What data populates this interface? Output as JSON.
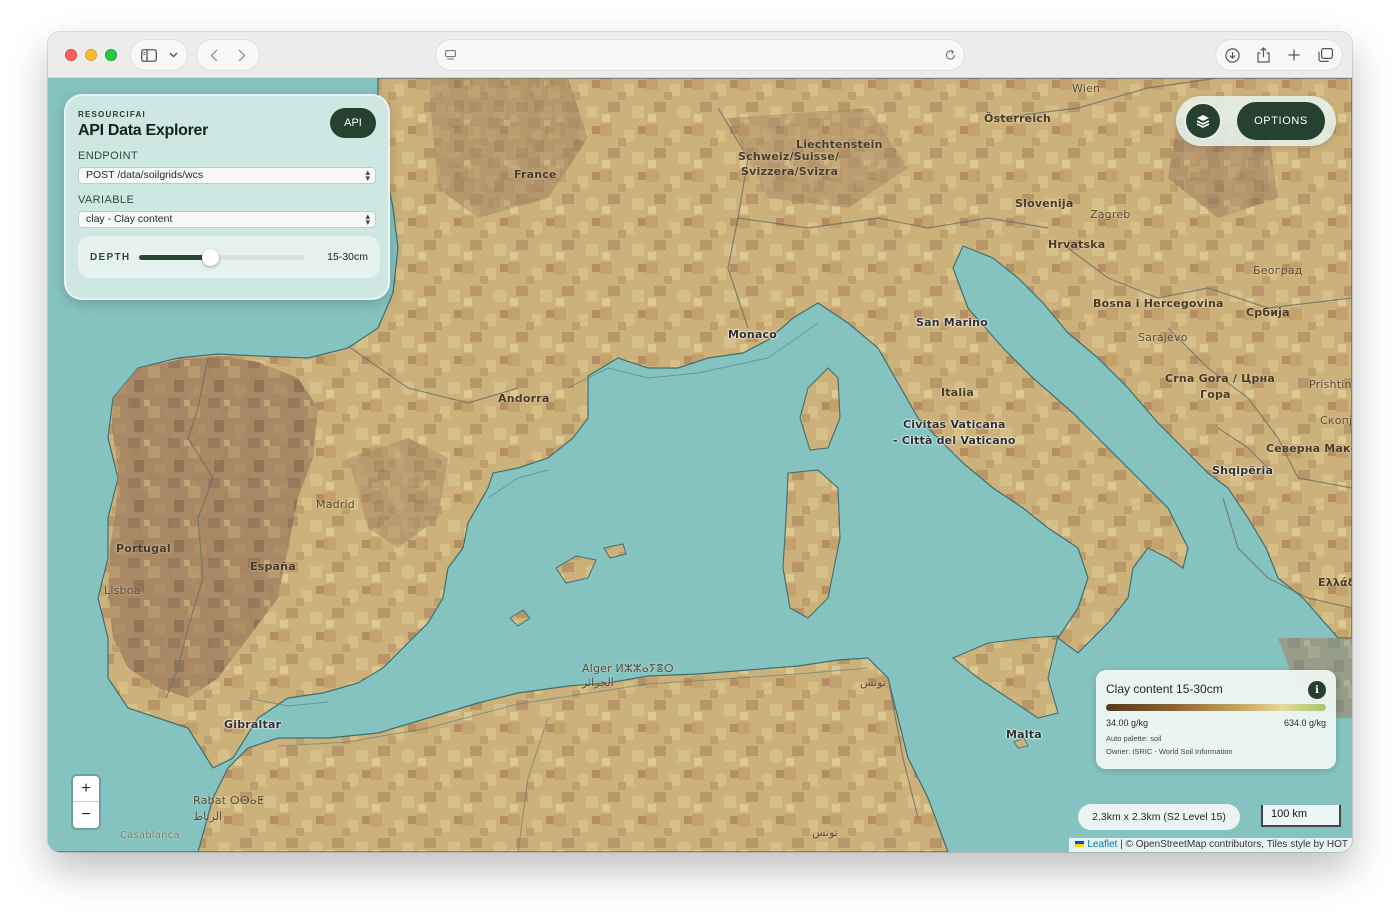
{
  "browser": {
    "url": ""
  },
  "panel": {
    "brand": "RESOURCIFAI",
    "title": "API Data Explorer",
    "api_label": "API",
    "endpoint_label": "ENDPOINT",
    "endpoint_value": "POST /data/soilgrids/wcs",
    "variable_label": "VARIABLE",
    "variable_value": "clay - Clay content",
    "depth_label": "DEPTH",
    "depth_value": "15-30cm",
    "depth_slider_fraction": 0.43
  },
  "options": {
    "label": "OPTIONS",
    "layers_icon": "layers-icon"
  },
  "legend": {
    "title": "Clay content 15-30cm",
    "info": "i",
    "min": "34.00 g/kg",
    "max": "634.0 g/kg",
    "palette": "Auto palette: soil",
    "owner": "Owner: ISRIC - World Soil Information",
    "colors": [
      "#55381c",
      "#8a6231",
      "#c6a45e",
      "#e6d79a",
      "#a3c86b"
    ]
  },
  "zoom": {
    "in": "+",
    "out": "−"
  },
  "resolution": "2.3km x 2.3km (S2 Level 15)",
  "scale": "100 km",
  "attribution": {
    "leaflet": "Leaflet",
    "rest": " | © OpenStreetMap contributors, Tiles style by HOT"
  },
  "places": {
    "wien": "Wien",
    "osterreich": "Österreich",
    "liechtenstein": "Liechtenstein",
    "schweiz": "Schweiz/Suisse/",
    "svizzera": "Svizzera/Svizra",
    "france": "France",
    "slovenija": "Slovenija",
    "zagreb": "Zagreb",
    "hrvatska": "Hrvatska",
    "beograd": "Београд",
    "bosna": "Bosna i Hercegovina",
    "srbija": "Србија",
    "sarajevo": "Sarajevo",
    "sanmarino": "San Marino",
    "monaco": "Monaco",
    "italia": "Italia",
    "cg": "Crna Gora / Црна",
    "gora": "Гора",
    "pristina": "Prishtinë",
    "skopje": "Скопје",
    "makedonija": "Северна Македон",
    "shqiperia": "Shqipëria",
    "vaticano1": "Civitas Vaticana",
    "vaticano2": "- Città del Vaticano",
    "andorra": "Andorra",
    "madrid": "Madrid",
    "espana": "España",
    "portugal": "Portugal",
    "lisboa": "Lisboa",
    "gibraltar": "Gibraltar",
    "alger": "Alger ⵍⵣⵣⴰⵢⴻⵔ",
    "djazair": "الجزائر",
    "tunis": "تونس",
    "malta": "Malta",
    "rabat": "Rabat ⵔⴱⴰⵟ",
    "ribat": "الرباط",
    "tounes": "تونس",
    "hellas": "Ελλάδα",
    "casablanca": "Casablanca"
  }
}
